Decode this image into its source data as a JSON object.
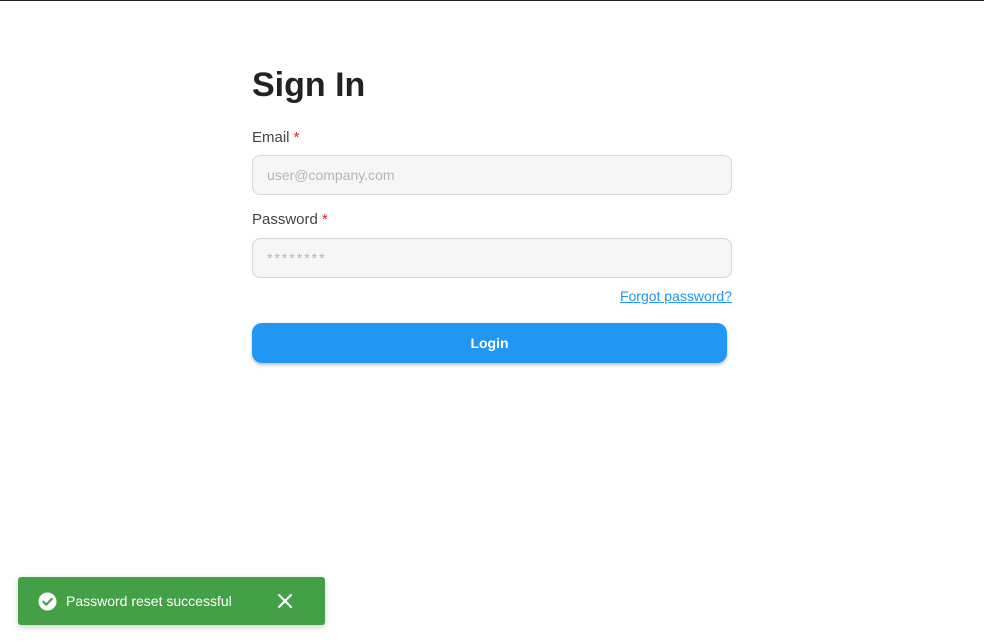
{
  "form": {
    "title": "Sign In",
    "email": {
      "label": "Email",
      "required_marker": "*",
      "placeholder": "user@company.com",
      "value": ""
    },
    "password": {
      "label": "Password",
      "required_marker": "*",
      "placeholder": "********",
      "value": ""
    },
    "forgot_link": "Forgot password?",
    "login_label": "Login"
  },
  "toast": {
    "message": "Password reset successful",
    "status_color": "#43a047",
    "icon": "check-circle-icon",
    "close_icon": "close-icon"
  },
  "colors": {
    "accent": "#2196f3",
    "required": "#e02020",
    "success": "#43a047"
  }
}
